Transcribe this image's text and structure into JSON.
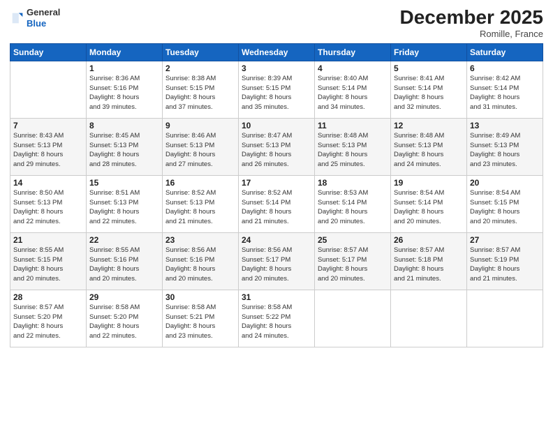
{
  "header": {
    "logo_general": "General",
    "logo_blue": "Blue",
    "month": "December 2025",
    "location": "Romille, France"
  },
  "days_of_week": [
    "Sunday",
    "Monday",
    "Tuesday",
    "Wednesday",
    "Thursday",
    "Friday",
    "Saturday"
  ],
  "weeks": [
    [
      {
        "day": "",
        "info": ""
      },
      {
        "day": "1",
        "info": "Sunrise: 8:36 AM\nSunset: 5:16 PM\nDaylight: 8 hours\nand 39 minutes."
      },
      {
        "day": "2",
        "info": "Sunrise: 8:38 AM\nSunset: 5:15 PM\nDaylight: 8 hours\nand 37 minutes."
      },
      {
        "day": "3",
        "info": "Sunrise: 8:39 AM\nSunset: 5:15 PM\nDaylight: 8 hours\nand 35 minutes."
      },
      {
        "day": "4",
        "info": "Sunrise: 8:40 AM\nSunset: 5:14 PM\nDaylight: 8 hours\nand 34 minutes."
      },
      {
        "day": "5",
        "info": "Sunrise: 8:41 AM\nSunset: 5:14 PM\nDaylight: 8 hours\nand 32 minutes."
      },
      {
        "day": "6",
        "info": "Sunrise: 8:42 AM\nSunset: 5:14 PM\nDaylight: 8 hours\nand 31 minutes."
      }
    ],
    [
      {
        "day": "7",
        "info": "Sunrise: 8:43 AM\nSunset: 5:13 PM\nDaylight: 8 hours\nand 29 minutes."
      },
      {
        "day": "8",
        "info": "Sunrise: 8:45 AM\nSunset: 5:13 PM\nDaylight: 8 hours\nand 28 minutes."
      },
      {
        "day": "9",
        "info": "Sunrise: 8:46 AM\nSunset: 5:13 PM\nDaylight: 8 hours\nand 27 minutes."
      },
      {
        "day": "10",
        "info": "Sunrise: 8:47 AM\nSunset: 5:13 PM\nDaylight: 8 hours\nand 26 minutes."
      },
      {
        "day": "11",
        "info": "Sunrise: 8:48 AM\nSunset: 5:13 PM\nDaylight: 8 hours\nand 25 minutes."
      },
      {
        "day": "12",
        "info": "Sunrise: 8:48 AM\nSunset: 5:13 PM\nDaylight: 8 hours\nand 24 minutes."
      },
      {
        "day": "13",
        "info": "Sunrise: 8:49 AM\nSunset: 5:13 PM\nDaylight: 8 hours\nand 23 minutes."
      }
    ],
    [
      {
        "day": "14",
        "info": "Sunrise: 8:50 AM\nSunset: 5:13 PM\nDaylight: 8 hours\nand 22 minutes."
      },
      {
        "day": "15",
        "info": "Sunrise: 8:51 AM\nSunset: 5:13 PM\nDaylight: 8 hours\nand 22 minutes."
      },
      {
        "day": "16",
        "info": "Sunrise: 8:52 AM\nSunset: 5:13 PM\nDaylight: 8 hours\nand 21 minutes."
      },
      {
        "day": "17",
        "info": "Sunrise: 8:52 AM\nSunset: 5:14 PM\nDaylight: 8 hours\nand 21 minutes."
      },
      {
        "day": "18",
        "info": "Sunrise: 8:53 AM\nSunset: 5:14 PM\nDaylight: 8 hours\nand 20 minutes."
      },
      {
        "day": "19",
        "info": "Sunrise: 8:54 AM\nSunset: 5:14 PM\nDaylight: 8 hours\nand 20 minutes."
      },
      {
        "day": "20",
        "info": "Sunrise: 8:54 AM\nSunset: 5:15 PM\nDaylight: 8 hours\nand 20 minutes."
      }
    ],
    [
      {
        "day": "21",
        "info": "Sunrise: 8:55 AM\nSunset: 5:15 PM\nDaylight: 8 hours\nand 20 minutes."
      },
      {
        "day": "22",
        "info": "Sunrise: 8:55 AM\nSunset: 5:16 PM\nDaylight: 8 hours\nand 20 minutes."
      },
      {
        "day": "23",
        "info": "Sunrise: 8:56 AM\nSunset: 5:16 PM\nDaylight: 8 hours\nand 20 minutes."
      },
      {
        "day": "24",
        "info": "Sunrise: 8:56 AM\nSunset: 5:17 PM\nDaylight: 8 hours\nand 20 minutes."
      },
      {
        "day": "25",
        "info": "Sunrise: 8:57 AM\nSunset: 5:17 PM\nDaylight: 8 hours\nand 20 minutes."
      },
      {
        "day": "26",
        "info": "Sunrise: 8:57 AM\nSunset: 5:18 PM\nDaylight: 8 hours\nand 21 minutes."
      },
      {
        "day": "27",
        "info": "Sunrise: 8:57 AM\nSunset: 5:19 PM\nDaylight: 8 hours\nand 21 minutes."
      }
    ],
    [
      {
        "day": "28",
        "info": "Sunrise: 8:57 AM\nSunset: 5:20 PM\nDaylight: 8 hours\nand 22 minutes."
      },
      {
        "day": "29",
        "info": "Sunrise: 8:58 AM\nSunset: 5:20 PM\nDaylight: 8 hours\nand 22 minutes."
      },
      {
        "day": "30",
        "info": "Sunrise: 8:58 AM\nSunset: 5:21 PM\nDaylight: 8 hours\nand 23 minutes."
      },
      {
        "day": "31",
        "info": "Sunrise: 8:58 AM\nSunset: 5:22 PM\nDaylight: 8 hours\nand 24 minutes."
      },
      {
        "day": "",
        "info": ""
      },
      {
        "day": "",
        "info": ""
      },
      {
        "day": "",
        "info": ""
      }
    ]
  ]
}
